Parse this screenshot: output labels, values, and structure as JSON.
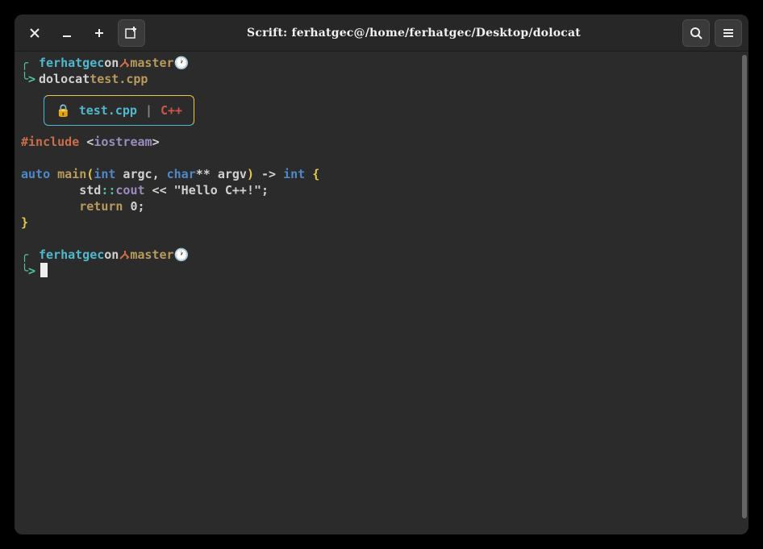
{
  "titlebar": {
    "title": "Scrift: ferhatgec@/home/ferhatgec/Desktop/dolocat"
  },
  "prompt1": {
    "user": "ferhatgec",
    "on": "on",
    "branch": "master",
    "clock": "🕐",
    "cmd": "dolocat",
    "arg": "test.cpp"
  },
  "filebox": {
    "lock": "🔒",
    "filename": "test.cpp",
    "sep": "|",
    "lang": "C++"
  },
  "code": {
    "l1_include": "#include",
    "l1_lt": " <",
    "l1_hdr": "iostream",
    "l1_gt": ">",
    "l2_auto": "auto",
    "l2_main": " main",
    "l2_op": "(",
    "l2_int": "int",
    "l2_argc": " argc",
    "l2_comma": ", ",
    "l2_char": "char",
    "l2_star": "**",
    "l2_argv": " argv",
    "l2_cp": ")",
    "l2_arrow": " -> ",
    "l2_int2": "int",
    "l2_ob": " {",
    "l3_indent": "        ",
    "l3_std": "std",
    "l3_cc": "::",
    "l3_cout": "cout",
    "l3_shl": " << ",
    "l3_str": "\"Hello C++!\"",
    "l3_semi": ";",
    "l4_indent": "        ",
    "l4_return": "return",
    "l4_zero": " 0",
    "l4_semi": ";",
    "l5_cb": "}"
  },
  "prompt2": {
    "user": "ferhatgec",
    "on": "on",
    "branch": "master",
    "clock": "🕐"
  }
}
